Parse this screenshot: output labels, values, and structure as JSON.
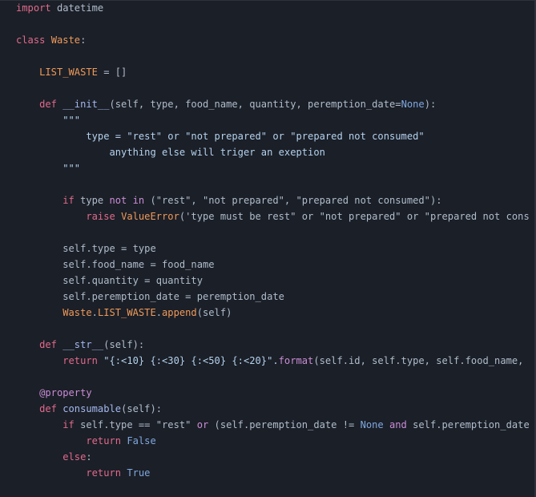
{
  "editor": {
    "lines": [
      [
        {
          "t": "import",
          "c": "kw"
        },
        {
          "t": " datetime",
          "c": "plain"
        }
      ],
      [],
      [
        {
          "t": "class",
          "c": "kw"
        },
        {
          "t": " ",
          "c": "plain"
        },
        {
          "t": "Waste",
          "c": "cls"
        },
        {
          "t": ":",
          "c": "plain"
        }
      ],
      [],
      [
        {
          "t": "    ",
          "c": "plain"
        },
        {
          "t": "LIST_WASTE",
          "c": "cls"
        },
        {
          "t": " = []",
          "c": "plain"
        }
      ],
      [],
      [
        {
          "t": "    ",
          "c": "plain"
        },
        {
          "t": "def",
          "c": "kw"
        },
        {
          "t": " ",
          "c": "plain"
        },
        {
          "t": "__init__",
          "c": "fn"
        },
        {
          "t": "(self, type, food_name, quantity, peremption_date=",
          "c": "plain"
        },
        {
          "t": "None",
          "c": "const"
        },
        {
          "t": "):",
          "c": "plain"
        }
      ],
      [
        {
          "t": "        \"\"\"",
          "c": "doc"
        }
      ],
      [
        {
          "t": "            type = \"rest\" or \"not prepared\" or \"prepared not consumed\"",
          "c": "doc"
        }
      ],
      [
        {
          "t": "                anything else will triger an exeption",
          "c": "doc"
        }
      ],
      [
        {
          "t": "        \"\"\"",
          "c": "doc"
        }
      ],
      [],
      [
        {
          "t": "        ",
          "c": "plain"
        },
        {
          "t": "if",
          "c": "kw"
        },
        {
          "t": " type ",
          "c": "plain"
        },
        {
          "t": "not in",
          "c": "kw2"
        },
        {
          "t": " (\"rest\", \"not prepared\", \"prepared not consumed\"):",
          "c": "plain"
        }
      ],
      [
        {
          "t": "            ",
          "c": "plain"
        },
        {
          "t": "raise",
          "c": "kw"
        },
        {
          "t": " ",
          "c": "plain"
        },
        {
          "t": "ValueError",
          "c": "builtin"
        },
        {
          "t": "('type must be rest\" or \"not prepared\" or \"prepared not cons",
          "c": "plain"
        }
      ],
      [],
      [
        {
          "t": "        self.type = type",
          "c": "plain"
        }
      ],
      [
        {
          "t": "        self.food_name = food_name",
          "c": "plain"
        }
      ],
      [
        {
          "t": "        self.quantity = quantity",
          "c": "plain"
        }
      ],
      [
        {
          "t": "        self.peremption_date = peremption_date",
          "c": "plain"
        }
      ],
      [
        {
          "t": "        ",
          "c": "plain"
        },
        {
          "t": "Waste",
          "c": "cls"
        },
        {
          "t": ".",
          "c": "plain"
        },
        {
          "t": "LIST_WASTE",
          "c": "cls"
        },
        {
          "t": ".",
          "c": "plain"
        },
        {
          "t": "append",
          "c": "cls"
        },
        {
          "t": "(self)",
          "c": "plain"
        }
      ],
      [],
      [
        {
          "t": "    ",
          "c": "plain"
        },
        {
          "t": "def",
          "c": "kw"
        },
        {
          "t": " ",
          "c": "plain"
        },
        {
          "t": "__str__",
          "c": "fn"
        },
        {
          "t": "(self):",
          "c": "plain"
        }
      ],
      [
        {
          "t": "        ",
          "c": "plain"
        },
        {
          "t": "return",
          "c": "kw"
        },
        {
          "t": " \"{:<10} {:<30} {:<50} {:<20}\".",
          "c": "str"
        },
        {
          "t": "format",
          "c": "kw2"
        },
        {
          "t": "(self.id, self.type, self.food_name,",
          "c": "plain"
        }
      ],
      [],
      [
        {
          "t": "    ",
          "c": "plain"
        },
        {
          "t": "@property",
          "c": "dec"
        }
      ],
      [
        {
          "t": "    ",
          "c": "plain"
        },
        {
          "t": "def",
          "c": "kw"
        },
        {
          "t": " ",
          "c": "plain"
        },
        {
          "t": "consumable",
          "c": "fn"
        },
        {
          "t": "(self):",
          "c": "plain"
        }
      ],
      [
        {
          "t": "        ",
          "c": "plain"
        },
        {
          "t": "if",
          "c": "kw"
        },
        {
          "t": " self.type == \"rest\" ",
          "c": "plain"
        },
        {
          "t": "or",
          "c": "kw2"
        },
        {
          "t": " (self.peremption_date != ",
          "c": "plain"
        },
        {
          "t": "None",
          "c": "const"
        },
        {
          "t": " ",
          "c": "plain"
        },
        {
          "t": "and",
          "c": "kw2"
        },
        {
          "t": " self.peremption_date",
          "c": "plain"
        }
      ],
      [
        {
          "t": "            ",
          "c": "plain"
        },
        {
          "t": "return",
          "c": "kw"
        },
        {
          "t": " ",
          "c": "plain"
        },
        {
          "t": "False",
          "c": "const"
        }
      ],
      [
        {
          "t": "        ",
          "c": "plain"
        },
        {
          "t": "else",
          "c": "kw"
        },
        {
          "t": ":",
          "c": "plain"
        }
      ],
      [
        {
          "t": "            ",
          "c": "plain"
        },
        {
          "t": "return",
          "c": "kw"
        },
        {
          "t": " ",
          "c": "plain"
        },
        {
          "t": "True",
          "c": "const"
        }
      ]
    ]
  },
  "colors": {
    "background": "#1b1f27",
    "keyword": "#e16a8b",
    "class_name": "#ef9a5b",
    "function_name": "#a3b8ef",
    "string": "#b4d2ef",
    "constant": "#7fa8e0",
    "decorator": "#c98cd6",
    "text": "#b0bdcc"
  }
}
